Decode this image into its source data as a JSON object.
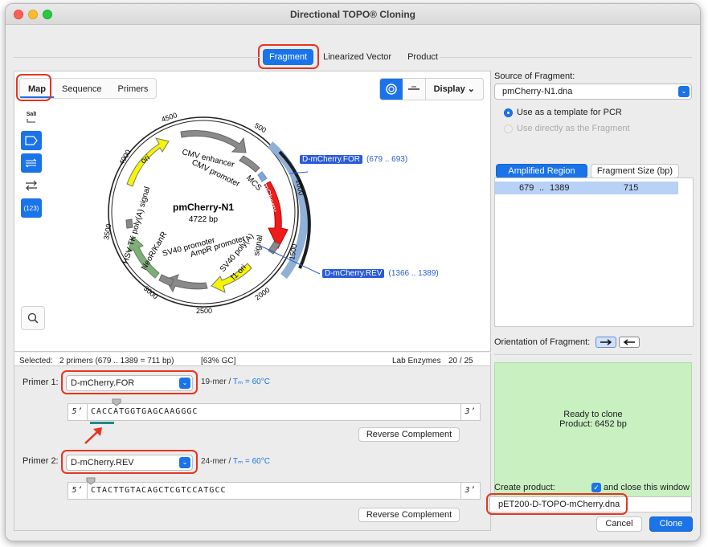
{
  "window": {
    "title": "Directional TOPO® Cloning"
  },
  "top_tabs": [
    {
      "label": "Fragment",
      "active": true
    },
    {
      "label": "Linearized Vector",
      "active": false
    },
    {
      "label": "Product",
      "active": false
    }
  ],
  "sub_tabs": [
    {
      "label": "Map",
      "active": true
    },
    {
      "label": "Sequence",
      "active": false
    },
    {
      "label": "Primers",
      "active": false
    }
  ],
  "display_menu": {
    "label": "Display"
  },
  "left_toolbar": {
    "enzyme_label": "SalI",
    "number_label": "(123)"
  },
  "map": {
    "name": "pmCherry-N1",
    "size": "4722 bp",
    "features": {
      "ori": "ori",
      "cmv_enhancer": "CMV enhancer",
      "cmv_promoter": "CMV promoter",
      "mcs": "MCS",
      "mcherry": "mCherry",
      "signal": "signal",
      "hsv_tk": "HSV TK poly(A) signal",
      "neor": "NeoR/KanR",
      "sv40_promoter": "SV40 promoter",
      "ampr_promoter": "AmpR promoter",
      "sv40_polya": "SV40 poly(A)",
      "f1_ori": "f1 ori"
    },
    "ticks": {
      "t500": "500",
      "t1000": "1000",
      "t1500": "1500",
      "t2000": "2000",
      "t2500": "2500",
      "t3000": "3000",
      "t3500": "3500",
      "t4000": "4000",
      "t4500": "4500"
    },
    "primer_for": {
      "name": "D-mCherry.FOR",
      "range": "(679 .. 693)"
    },
    "primer_rev": {
      "name": "D-mCherry.REV",
      "range": "(1366 .. 1389)"
    }
  },
  "status": {
    "selected_label": "Selected:",
    "selected_value": "2 primers  (679 .. 1389  =  711 bp)",
    "gc": "[63% GC]",
    "enzymes": "Lab Enzymes",
    "enzyme_count": "20 / 25"
  },
  "primer1": {
    "label": "Primer 1:",
    "name": "D-mCherry.FOR",
    "length": "19-mer",
    "tm": "= 60°C",
    "tm_label": "Tₘ",
    "five": "5’",
    "three": "3’",
    "sequence": "CACCATGGTGAGCAAGGGC",
    "reverse_complement": "Reverse Complement"
  },
  "primer2": {
    "label": "Primer 2:",
    "name": "D-mCherry.REV",
    "length": "24-mer",
    "tm": "= 60°C",
    "tm_label": "Tₘ",
    "five": "5’",
    "three": "3’",
    "sequence": "CTACTTGTACAGCTCGTCCATGCC",
    "reverse_complement": "Reverse Complement"
  },
  "source": {
    "label": "Source of Fragment:",
    "file": "pmCherry-N1.dna",
    "option_template": "Use as a template for PCR",
    "option_direct": "Use directly as the Fragment"
  },
  "region_tabs": {
    "amplified": "Amplified Region",
    "fragment_size": "Fragment Size (bp)"
  },
  "region_row": {
    "start": "679",
    "sep": "..",
    "end": "1389",
    "size": "715"
  },
  "orientation": {
    "label": "Orientation of Fragment:"
  },
  "ready": {
    "line1": "Ready to clone",
    "line2": "Product:  6452 bp"
  },
  "create": {
    "label": "Create product:",
    "close_label": "and close this window",
    "name": "pET200-D-TOPO-mCherry.dna"
  },
  "buttons": {
    "cancel": "Cancel",
    "clone": "Clone"
  },
  "colors": {
    "accent": "#1a73e8",
    "highlight": "#e8331f",
    "ready": "#c8f0c0"
  }
}
